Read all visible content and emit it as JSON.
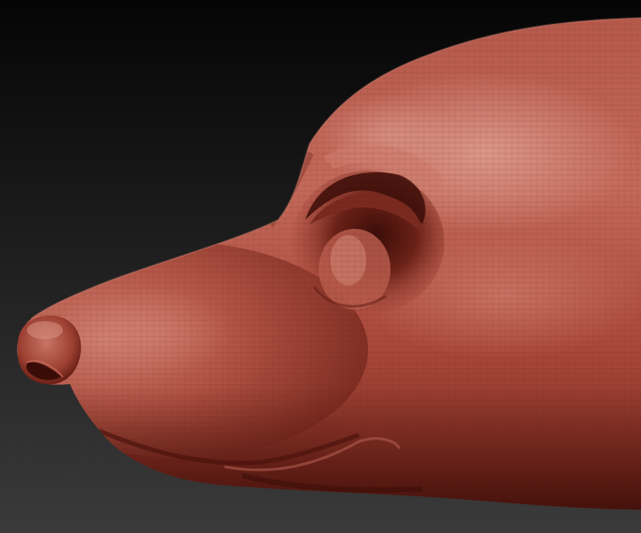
{
  "viewport": {
    "subject": "sculpted-dog-head-profile",
    "material": "red-wax-matcap",
    "colors": {
      "background_top": "#050505",
      "background_bottom": "#3a3a3a",
      "clay_base": "#9a3a2c",
      "clay_light": "#c86b5c",
      "clay_highlight": "#e0a394",
      "clay_shadow": "#5a1810",
      "clay_deep": "#2e0a06",
      "wire": "#6a2218"
    }
  }
}
